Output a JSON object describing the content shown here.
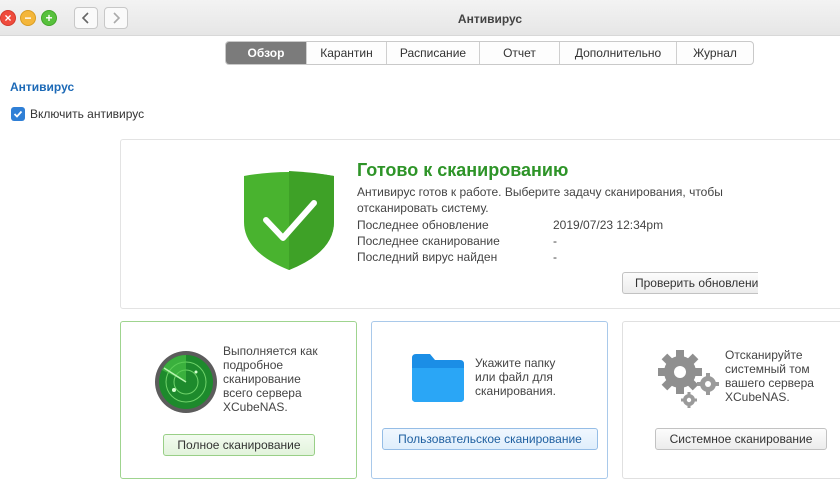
{
  "window": {
    "title": "Антивирус",
    "controls": [
      "close-icon",
      "minimize-icon",
      "maximize-icon"
    ],
    "nav": [
      "chevron-left-icon",
      "chevron-right-icon"
    ]
  },
  "tabs": [
    {
      "label": "Обзор",
      "active": true
    },
    {
      "label": "Карантин",
      "active": false
    },
    {
      "label": "Расписание",
      "active": false
    },
    {
      "label": "Отчет",
      "active": false
    },
    {
      "label": "Дополнительно",
      "active": false
    },
    {
      "label": "Журнал",
      "active": false
    }
  ],
  "section": {
    "title": "Антивирус",
    "enable_checkbox": {
      "label": "Включить антивирус",
      "checked": true
    }
  },
  "status": {
    "icon": "shield-check-icon",
    "title": "Готово к сканированию",
    "description": "Антивирус готов к работе. Выберите задачу сканирования, чтобы отсканировать систему.",
    "rows": [
      {
        "label": "Последнее обновление",
        "value": "2019/07/23 12:34pm"
      },
      {
        "label": "Последнее сканирование",
        "value": "-"
      },
      {
        "label": "Последний вирус найден",
        "value": "-"
      }
    ],
    "update_button": "Проверить обновлени"
  },
  "cards": {
    "full": {
      "icon": "radar-icon",
      "text": "Выполняется как подробное сканирование всего сервера XCubeNAS.",
      "button": "Полное сканирование"
    },
    "custom": {
      "icon": "folder-icon",
      "text": "Укажите папку или файл для сканирования.",
      "button": "Пользовательское сканирование"
    },
    "system": {
      "icon": "gears-icon",
      "text": "Отсканируйте системный том вашего сервера XCubeNAS.",
      "button": "Системное сканирование"
    }
  },
  "colors": {
    "accent": "#2f7fd6",
    "ready_green": "#2e9428",
    "active_tab": "#7b7b7b"
  }
}
